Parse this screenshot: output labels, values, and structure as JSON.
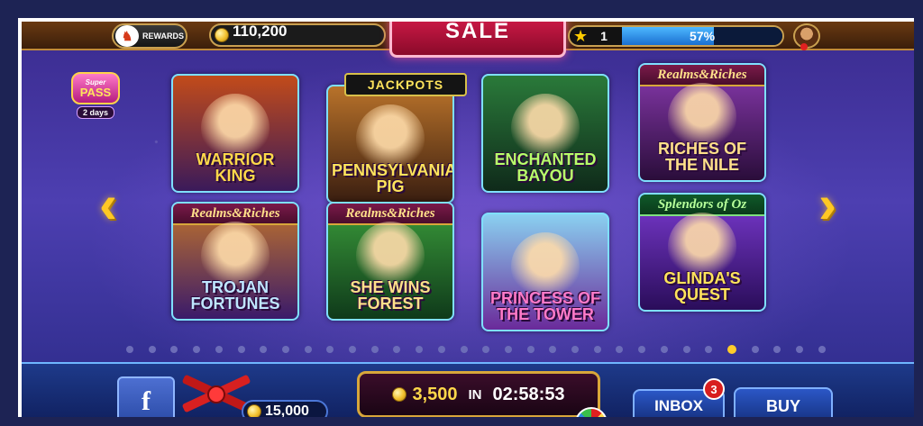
{
  "topbar": {
    "rewards_label": "REWARDS",
    "rewards_icon": "rooster-icon",
    "coins": "110,200",
    "sale_label": "SALE",
    "level": "1",
    "xp_percent_label": "57%",
    "xp_percent": 57
  },
  "superpass": {
    "top": "Super",
    "main": "PASS",
    "days": "2 days"
  },
  "tiles": [
    {
      "title": "WARRIOR KING",
      "banner": "",
      "bg": [
        "#c24b1a",
        "#3a1a5a"
      ],
      "title_color": "#ffd84a"
    },
    {
      "title": "PENNSYLVANIA PIG",
      "banner": "",
      "bg": [
        "#b8722a",
        "#3a1e10"
      ],
      "title_color": "#ffe45c"
    },
    {
      "title": "ENCHANTED BAYOU",
      "banner": "",
      "bg": [
        "#2a7a3a",
        "#0f2a1a"
      ],
      "title_color": "#b8ff6a"
    },
    {
      "title": "RICHES OF THE NILE",
      "banner": "Realms&Riches",
      "bg": [
        "#8a3ab0",
        "#2a0d3a"
      ],
      "title_color": "#ffe08a"
    },
    {
      "title": "TROJAN FORTUNES",
      "banner": "Realms&Riches",
      "bg": [
        "#c2742a",
        "#3a1a6a"
      ],
      "title_color": "#bfe6ff"
    },
    {
      "title": "SHE WINS FOREST",
      "banner": "Realms&Riches",
      "bg": [
        "#3a9a3a",
        "#0f3a1a"
      ],
      "title_color": "#ffe08a"
    },
    {
      "title": "PRINCESS OF THE TOWER",
      "banner": "",
      "bg": [
        "#8ad0f0",
        "#6a2a9a"
      ],
      "title_color": "#ff7ac8"
    },
    {
      "title": "GLINDA'S QUEST",
      "banner": "Splendors of Oz",
      "bg": [
        "#7a3ad0",
        "#2a0d5a"
      ],
      "title_color": "#ffe45c"
    }
  ],
  "jackpots_label": "JACKPOTS",
  "pager": {
    "count": 32,
    "active_index": 27
  },
  "bottom": {
    "facebook_label": "f",
    "bonus_coins": "15,000",
    "timer_amount": "3,500",
    "timer_in": "IN",
    "timer_time": "02:58:53",
    "inbox_label": "INBOX",
    "inbox_count": "3",
    "buy_label": "BUY"
  },
  "colors": {
    "accent_gold": "#ffc824",
    "frame": "#1d2354"
  }
}
